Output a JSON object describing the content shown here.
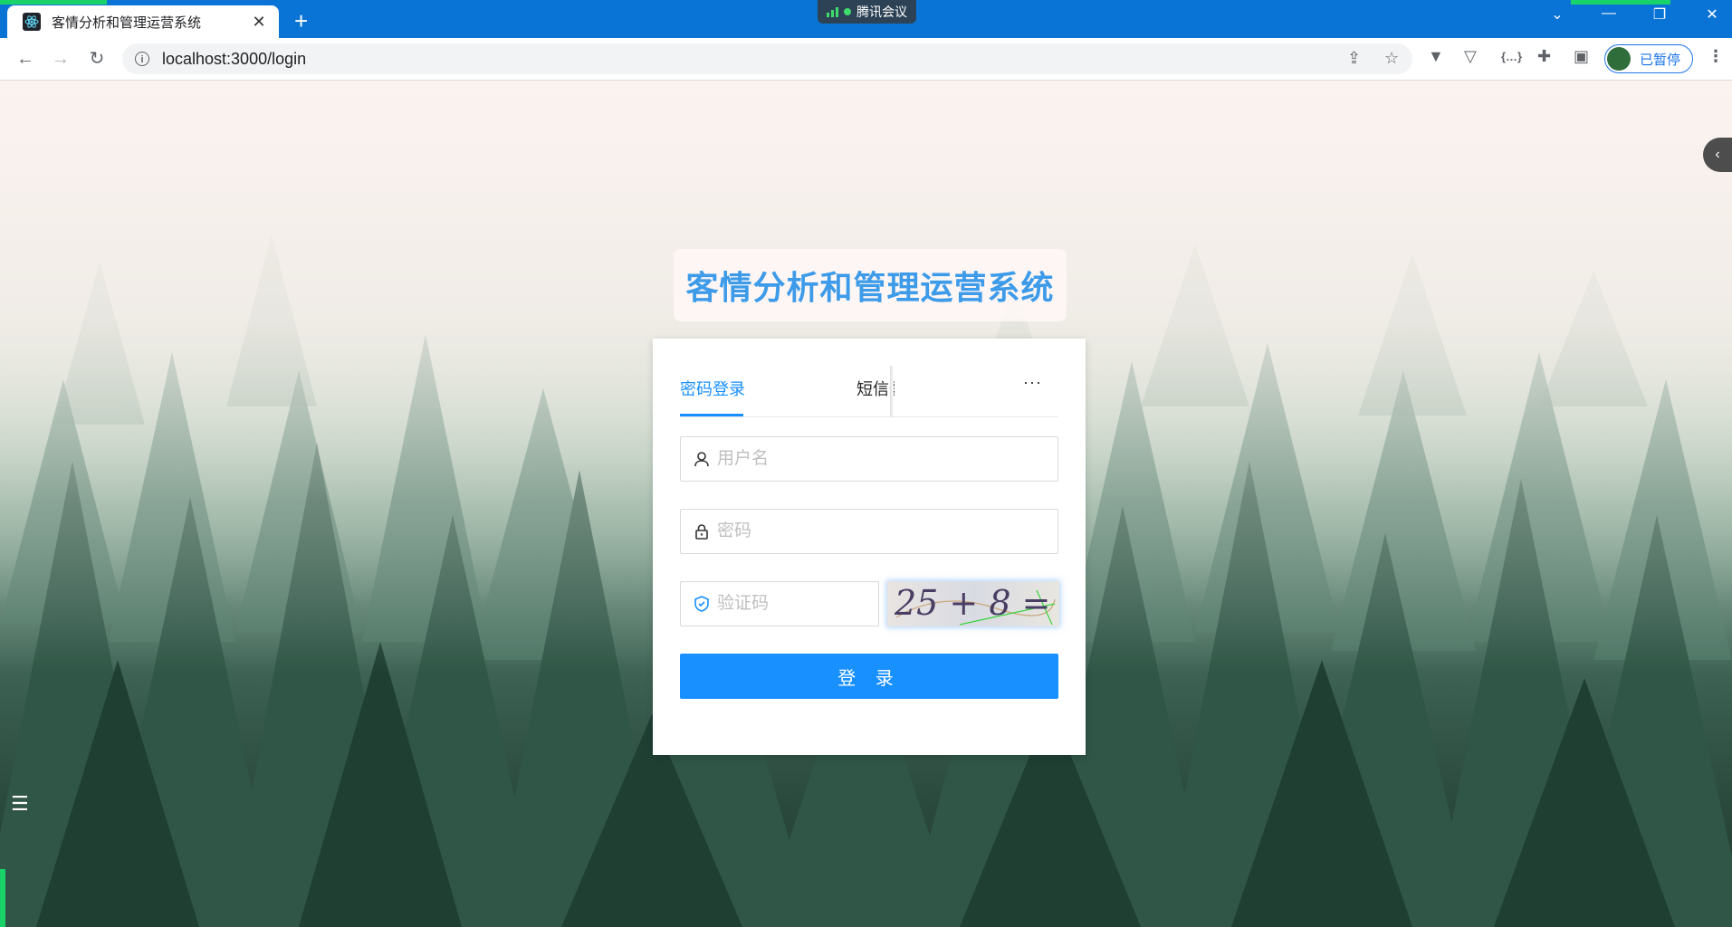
{
  "browser": {
    "tab_title": "客情分析和管理运营系统",
    "url": "localhost:3000/login",
    "meeting_label": "腾讯会议",
    "profile_label": "已暂停"
  },
  "page": {
    "system_title": "客情分析和管理运营系统",
    "tabs": {
      "password_login": "密码登录",
      "sms_login": "短信登录",
      "more": "···"
    },
    "username_placeholder": "用户名",
    "password_placeholder": "密码",
    "captcha_placeholder": "验证码",
    "captcha_text": "25 + 8 =",
    "login_button": "登 录"
  },
  "colors": {
    "accent": "#1890ff",
    "title": "#3d9be9",
    "chrome": "#0a74d6"
  }
}
